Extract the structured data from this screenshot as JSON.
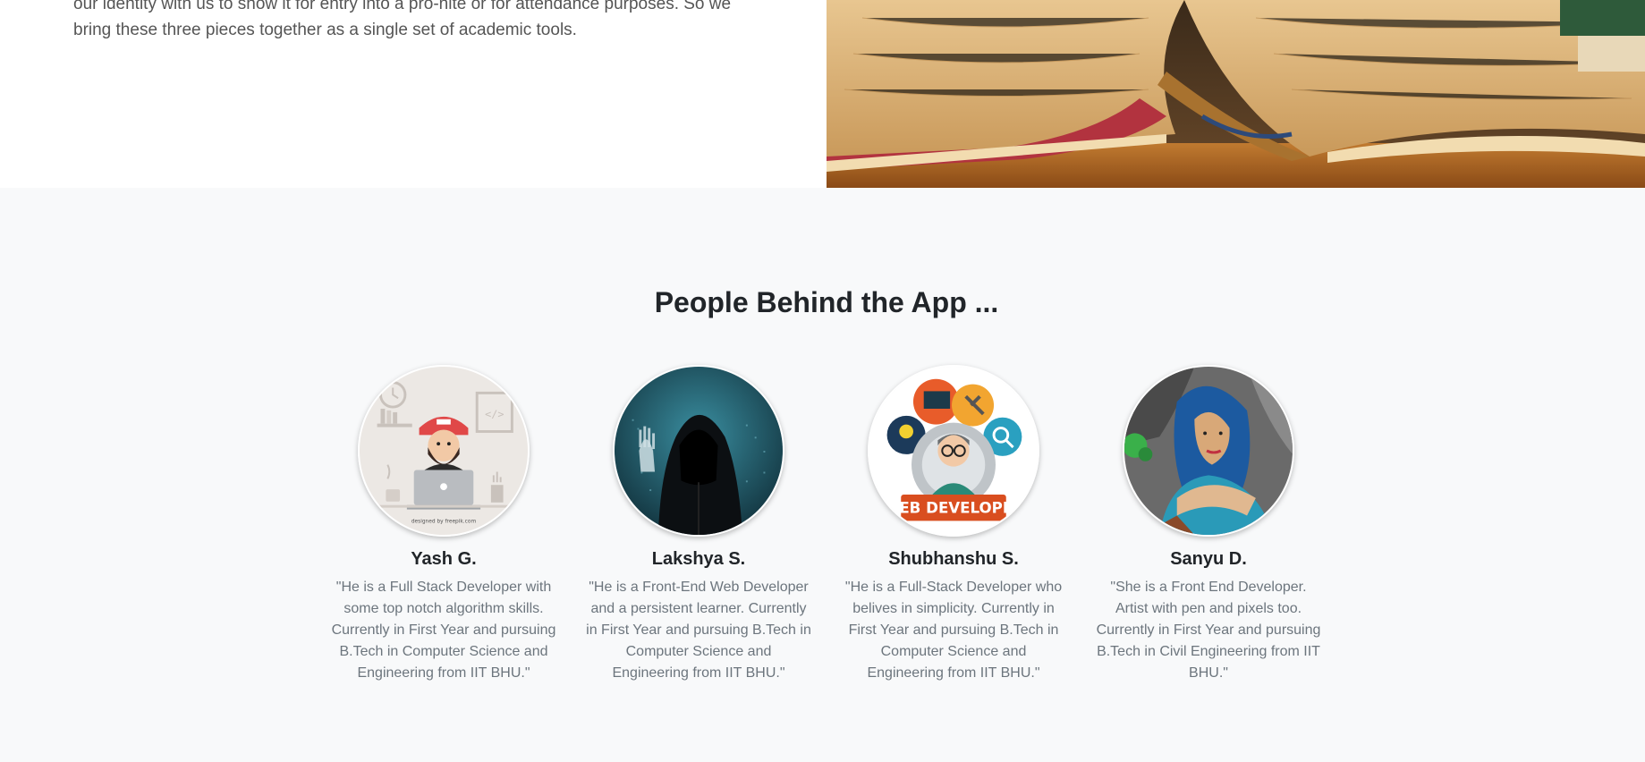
{
  "intro": {
    "text": "our identity with us to show it for entry into a pro-nite or for attendance purposes. So we bring these three pieces together as a single set of academic tools."
  },
  "team": {
    "heading": "People Behind the App ...",
    "members": [
      {
        "name": "Yash G.",
        "bio": "\"He is a Full Stack Developer with some top notch algorithm skills. Currently in First Year and pursuing B.Tech in Computer Science and Engineering from IIT BHU.\"",
        "avatar_icon": "developer-laptop-illustration",
        "avatar_caption": "designed by freepik.com"
      },
      {
        "name": "Lakshya S.",
        "bio": "\"He is a Front-End Web Developer and a persistent learner. Currently in First Year and pursuing B.Tech in Computer Science and Engineering from IIT BHU.\"",
        "avatar_icon": "hooded-hacker-illustration"
      },
      {
        "name": "Shubhanshu S.",
        "bio": "\"He is a Full-Stack Developer who belives in simplicity. Currently in First Year and pursuing B.Tech in Computer Science and Engineering from IIT BHU.\"",
        "avatar_icon": "web-developer-badge-illustration",
        "avatar_badge": "WEB DEVELOPER"
      },
      {
        "name": "Sanyu D.",
        "bio": "\"She is a Front End Developer. Artist with pen and pixels too. Currently in First Year and pursuing B.Tech in Civil Engineering from IIT BHU.\"",
        "avatar_icon": "painted-portrait-illustration"
      }
    ]
  }
}
